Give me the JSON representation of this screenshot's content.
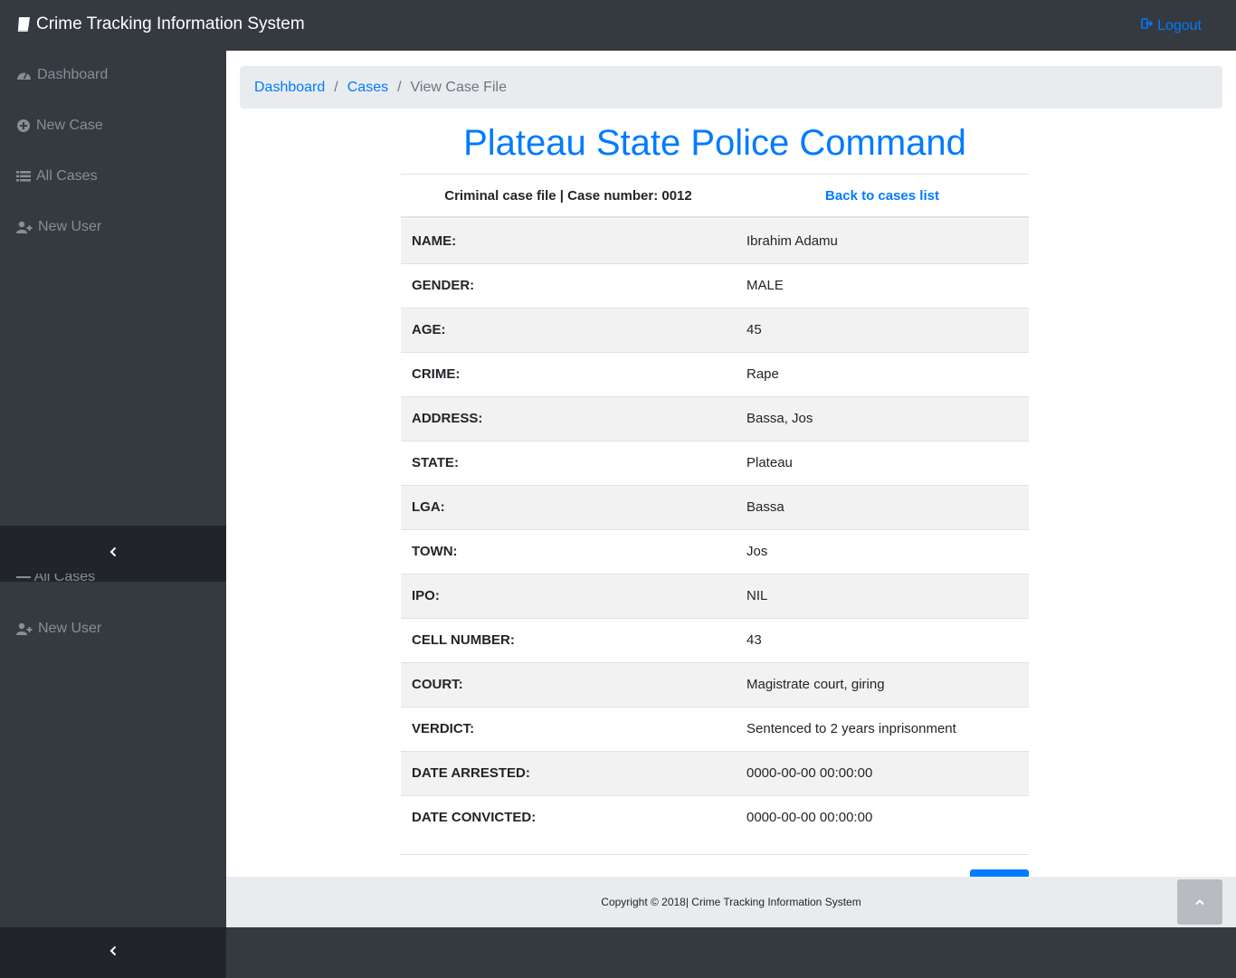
{
  "header": {
    "brand_title": "Crime Tracking Information System",
    "logout_label": "Logout",
    "brand_icon": "book-icon",
    "logout_icon": "sign-out-icon"
  },
  "sidebar": {
    "items": [
      {
        "label": "Dashboard",
        "icon": "tachometer-icon"
      },
      {
        "label": "New Case",
        "icon": "plus-circle-icon"
      },
      {
        "label": "All Cases",
        "icon": "list-icon"
      },
      {
        "label": "New User",
        "icon": "user-plus-icon"
      }
    ],
    "ghost_label": "All Cases",
    "repeat_item": {
      "label": "New User",
      "icon": "user-plus-icon"
    },
    "toggle_icon": "chevron-left-icon"
  },
  "breadcrumb": {
    "items": [
      {
        "label": "Dashboard",
        "link": true
      },
      {
        "label": "Cases",
        "link": true
      },
      {
        "label": "View Case File",
        "link": false
      }
    ],
    "separator": "/"
  },
  "page": {
    "title": "Plateau State Police Command",
    "case_line": "Criminal case file | Case number: 0012",
    "back_link": "Back to cases list"
  },
  "case_details": [
    {
      "label": "NAME:",
      "value": "Ibrahim Adamu"
    },
    {
      "label": "GENDER:",
      "value": "MALE"
    },
    {
      "label": "AGE:",
      "value": "45"
    },
    {
      "label": "CRIME:",
      "value": "Rape"
    },
    {
      "label": "ADDRESS:",
      "value": "Bassa, Jos"
    },
    {
      "label": "STATE:",
      "value": "Plateau"
    },
    {
      "label": "LGA:",
      "value": "Bassa"
    },
    {
      "label": "TOWN:",
      "value": "Jos"
    },
    {
      "label": "IPO:",
      "value": "NIL"
    },
    {
      "label": "CELL NUMBER:",
      "value": "43"
    },
    {
      "label": "COURT:",
      "value": "Magistrate court, giring"
    },
    {
      "label": "VERDICT:",
      "value": "Sentenced to 2 years inprisonment"
    },
    {
      "label": "DATE ARRESTED:",
      "value": "0000-00-00 00:00:00"
    },
    {
      "label": "DATE CONVICTED:",
      "value": "0000-00-00 00:00:00"
    }
  ],
  "footer": {
    "copyright": "Copyright © 2018| Crime Tracking Information System",
    "scroll_icon": "chevron-up-icon"
  },
  "colors": {
    "accent": "#007bff",
    "sidebar_bg": "#343a40",
    "toggler_bg": "#212529",
    "breadcrumb_bg": "#e9ecef"
  }
}
